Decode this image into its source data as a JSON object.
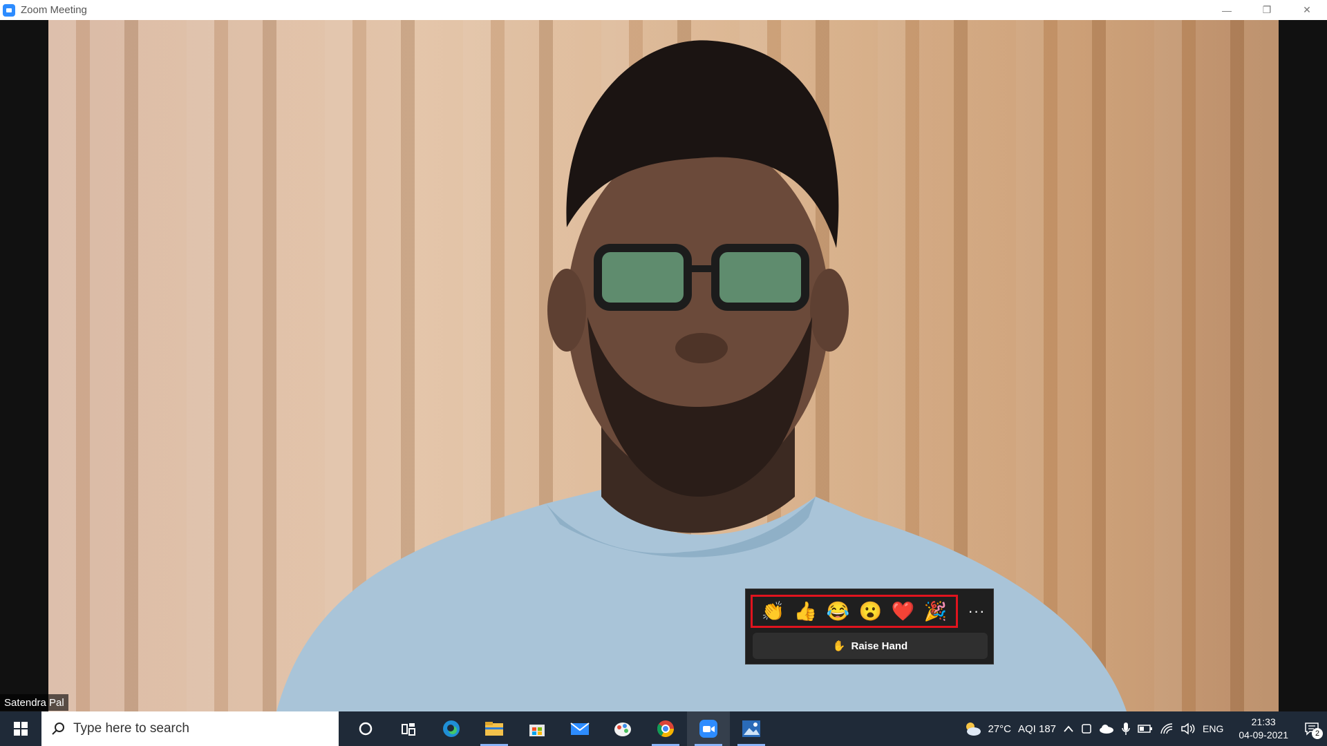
{
  "window": {
    "title": "Zoom Meeting",
    "controls": {
      "minimize": "—",
      "restore": "❐",
      "close": "✕"
    }
  },
  "video": {
    "participant_name": "Satendra Pal"
  },
  "reactions": {
    "emojis": [
      {
        "name": "clap",
        "glyph": "👏"
      },
      {
        "name": "thumbs-up",
        "glyph": "👍"
      },
      {
        "name": "tears-of-joy",
        "glyph": "😂"
      },
      {
        "name": "open-mouth",
        "glyph": "😮"
      },
      {
        "name": "heart",
        "glyph": "❤️"
      },
      {
        "name": "tada",
        "glyph": "🎉"
      }
    ],
    "more": "···",
    "raise_hand": {
      "glyph": "✋",
      "label": "Raise Hand"
    },
    "highlight_color": "#e0141e"
  },
  "taskbar": {
    "search_placeholder": "Type here to search",
    "apps": [
      "cortana",
      "task-view",
      "edge",
      "file-explorer",
      "store",
      "mail",
      "paint",
      "chrome",
      "zoom",
      "photos"
    ],
    "weather": {
      "temp": "27°C",
      "aqi": "AQI 187"
    },
    "language": "ENG",
    "time": "21:33",
    "date": "04-09-2021",
    "notification_count": "2"
  }
}
